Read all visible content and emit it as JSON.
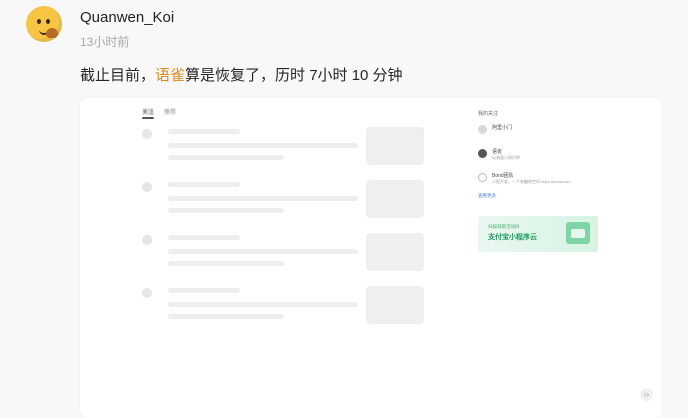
{
  "post": {
    "author": "Quanwen_Koi",
    "time": "13小时前",
    "text_before": "截止目前，",
    "text_link": "语雀",
    "text_after": "算是恢复了，历时 7小时 10 分钟",
    "link_color": "#e2891c"
  },
  "screenshot": {
    "tabs": [
      "关注",
      "推荐"
    ],
    "feed_items": 4,
    "sidebar": {
      "title": "我的关注",
      "items": [
        {
          "name": "阿里小门",
          "desc": ""
        },
        {
          "name": "语雀",
          "desc": "玩具蛋小知识库"
        },
        {
          "name": "Bond团队",
          "desc": "小报开发，一个有趣的空间  https://bond.com"
        }
      ],
      "more": "查看更多"
    },
    "banner": {
      "line1": "扫描领取活动码",
      "line2": "支付宝小程序云"
    }
  },
  "colors": {
    "background": "#f8f8f8",
    "accent": "#e2891c"
  },
  "icons": {
    "avatar": "emoji-avatar",
    "fab": "chevron-icon"
  }
}
